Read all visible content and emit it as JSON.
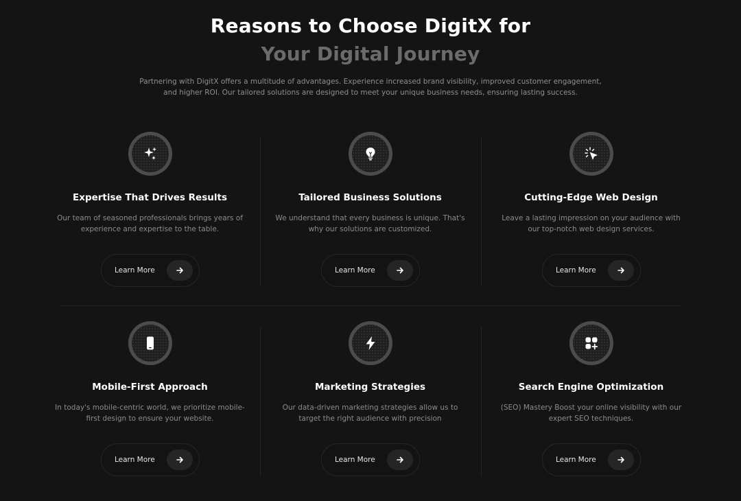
{
  "header": {
    "title_line1": "Reasons to Choose DigitX for",
    "title_line2": "Your Digital Journey",
    "intro": "Partnering with DigitX offers a multitude of advantages. Experience increased brand visibility, improved customer engagement, and higher ROI. Our tailored solutions are designed to meet your unique business needs, ensuring lasting success."
  },
  "colors": {
    "background": "#141414",
    "title_primary": "#ffffff",
    "title_secondary": "#6b6b6b",
    "body_text": "#8c8c8c"
  },
  "features": [
    {
      "icon": "sparkles-icon",
      "title": "Expertise That Drives Results",
      "description": "Our team of seasoned professionals brings years of experience and expertise to the table.",
      "button_label": "Learn More"
    },
    {
      "icon": "lightbulb-icon",
      "title": "Tailored Business Solutions",
      "description": "We understand that every business is unique. That's why our solutions are customized.",
      "button_label": "Learn More"
    },
    {
      "icon": "cursor-click-icon",
      "title": "Cutting-Edge Web Design",
      "description": "Leave a lasting impression on your audience with our top-notch web design services.",
      "button_label": "Learn More"
    },
    {
      "icon": "smartphone-icon",
      "title": "Mobile-First Approach",
      "description": "In today's mobile-centric world, we prioritize mobile-first design to ensure your website.",
      "button_label": "Learn More"
    },
    {
      "icon": "lightning-bolt-icon",
      "title": "Marketing Strategies",
      "description": "Our data-driven marketing strategies allow us to target the right audience with precision",
      "button_label": "Learn More"
    },
    {
      "icon": "apps-add-icon",
      "title": "Search Engine Optimization",
      "description": "(SEO) Mastery Boost your online visibility with our expert SEO techniques.",
      "button_label": "Learn More"
    }
  ]
}
